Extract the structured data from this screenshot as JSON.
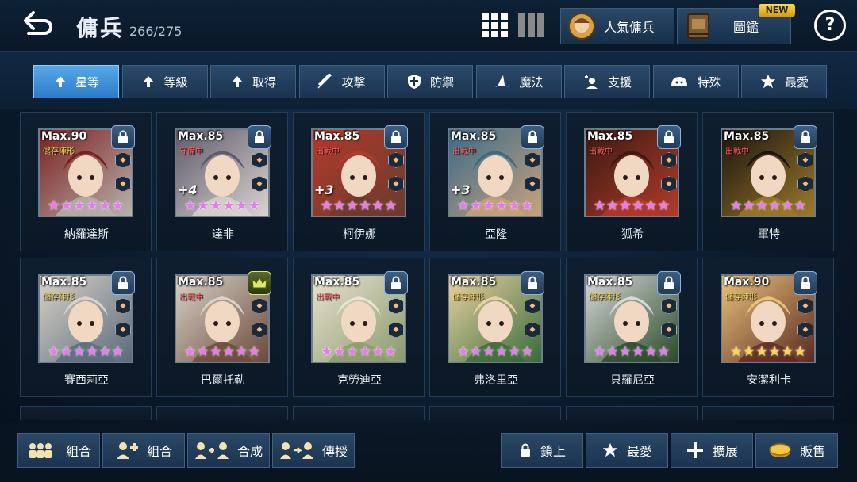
{
  "header": {
    "title": "傭兵",
    "count": "266/275",
    "popular_label": "人氣傭兵",
    "book_label": "圖鑑",
    "new_badge": "NEW",
    "help_glyph": "?"
  },
  "filters": [
    {
      "label": "星等",
      "icon": "up-arrow-icon",
      "active": true
    },
    {
      "label": "等級",
      "icon": "up-arrow-icon"
    },
    {
      "label": "取得",
      "icon": "up-arrow-icon"
    },
    {
      "label": "攻擊",
      "icon": "sword-icon"
    },
    {
      "label": "防禦",
      "icon": "shield-icon"
    },
    {
      "label": "魔法",
      "icon": "wizard-hat-icon"
    },
    {
      "label": "支援",
      "icon": "support-icon"
    },
    {
      "label": "特殊",
      "icon": "slime-icon"
    },
    {
      "label": "最愛",
      "icon": "star-icon"
    }
  ],
  "heroes": [
    {
      "name": "納羅達斯",
      "max": "Max.90",
      "status": "儲存陣形",
      "plus": "",
      "stars": 6,
      "star_color": "purple",
      "lock": "lock-icon",
      "c1": "#b7b2ad",
      "c2": "#7a2020"
    },
    {
      "name": "達非",
      "max": "Max.85",
      "status": "守備中",
      "plus": "+4",
      "stars": 6,
      "star_color": "purple",
      "lock": "lock-icon",
      "c1": "#d9d4cf",
      "c2": "#5e5a6a"
    },
    {
      "name": "柯伊娜",
      "max": "Max.85",
      "status": "出戰中",
      "plus": "+3",
      "stars": 6,
      "star_color": "purple",
      "lock": "lock-icon",
      "c1": "#6a3b2e",
      "c2": "#b23a2a"
    },
    {
      "name": "亞隆",
      "max": "Max.85",
      "status": "出戰中",
      "plus": "+3",
      "stars": 6,
      "star_color": "purple",
      "lock": "lock-icon",
      "c1": "#c8a27a",
      "c2": "#3a6a8a"
    },
    {
      "name": "狐希",
      "max": "Max.85",
      "status": "出戰中",
      "plus": "",
      "stars": 6,
      "star_color": "purple",
      "lock": "lock-icon",
      "c1": "#b33a2a",
      "c2": "#3a1a12"
    },
    {
      "name": "軍特",
      "max": "Max.85",
      "status": "出戰中",
      "plus": "",
      "stars": 6,
      "star_color": "purple",
      "lock": "lock-icon",
      "c1": "#9c7a2a",
      "c2": "#1a1410"
    },
    {
      "name": "賽西莉亞",
      "max": "Max.85",
      "status": "儲存陣形",
      "plus": "",
      "stars": 6,
      "star_color": "purple",
      "lock": "lock-icon",
      "c1": "#5a6a7a",
      "c2": "#d9d2c8"
    },
    {
      "name": "巴爾托勒",
      "max": "Max.85",
      "status": "出戰中",
      "plus": "",
      "stars": 6,
      "star_color": "purple",
      "lock": "crown-icon",
      "c1": "#6a4a3a",
      "c2": "#d9d2c8"
    },
    {
      "name": "克勞迪亞",
      "max": "Max.85",
      "status": "出戰中",
      "plus": "",
      "stars": 6,
      "star_color": "purple",
      "lock": "lock-icon",
      "c1": "#8a9a6a",
      "c2": "#e8e2d2"
    },
    {
      "name": "弗洛里亞",
      "max": "Max.85",
      "status": "儲存陣形",
      "plus": "",
      "stars": 6,
      "star_color": "purple",
      "lock": "lock-icon",
      "c1": "#3a6a3a",
      "c2": "#e8d2a2"
    },
    {
      "name": "貝羅尼亞",
      "max": "Max.85",
      "status": "儲存陣形",
      "plus": "",
      "stars": 6,
      "star_color": "purple",
      "lock": "lock-icon",
      "c1": "#2a4a2a",
      "c2": "#d8d8d8"
    },
    {
      "name": "安潔利卡",
      "max": "Max.90",
      "status": "儲存陣形",
      "plus": "",
      "stars": 6,
      "star_color": "gold",
      "lock": "lock-icon",
      "c1": "#5a2a22",
      "c2": "#e8c27a"
    }
  ],
  "bottom_left": [
    {
      "label": "組合",
      "icon": "team-icon"
    },
    {
      "label": "組合",
      "icon": "puzzle-icon"
    },
    {
      "label": "合成",
      "icon": "fuse-icon"
    },
    {
      "label": "傳授",
      "icon": "transfer-icon"
    }
  ],
  "bottom_right": [
    {
      "label": "鎖上",
      "icon": "lock-icon"
    },
    {
      "label": "最愛",
      "icon": "star-icon"
    },
    {
      "label": "擴展",
      "icon": "plus-icon"
    },
    {
      "label": "販售",
      "icon": "coin-icon"
    }
  ]
}
